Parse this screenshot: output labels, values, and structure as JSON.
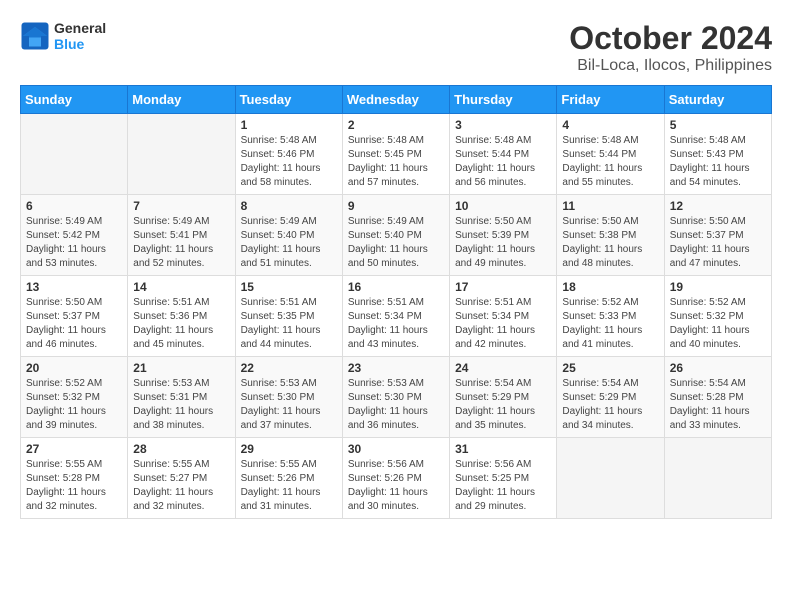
{
  "header": {
    "logo_line1": "General",
    "logo_line2": "Blue",
    "title": "October 2024",
    "subtitle": "Bil-Loca, Ilocos, Philippines"
  },
  "weekdays": [
    "Sunday",
    "Monday",
    "Tuesday",
    "Wednesday",
    "Thursday",
    "Friday",
    "Saturday"
  ],
  "weeks": [
    [
      {
        "day": "",
        "info": ""
      },
      {
        "day": "",
        "info": ""
      },
      {
        "day": "1",
        "info": "Sunrise: 5:48 AM\nSunset: 5:46 PM\nDaylight: 11 hours and 58 minutes."
      },
      {
        "day": "2",
        "info": "Sunrise: 5:48 AM\nSunset: 5:45 PM\nDaylight: 11 hours and 57 minutes."
      },
      {
        "day": "3",
        "info": "Sunrise: 5:48 AM\nSunset: 5:44 PM\nDaylight: 11 hours and 56 minutes."
      },
      {
        "day": "4",
        "info": "Sunrise: 5:48 AM\nSunset: 5:44 PM\nDaylight: 11 hours and 55 minutes."
      },
      {
        "day": "5",
        "info": "Sunrise: 5:48 AM\nSunset: 5:43 PM\nDaylight: 11 hours and 54 minutes."
      }
    ],
    [
      {
        "day": "6",
        "info": "Sunrise: 5:49 AM\nSunset: 5:42 PM\nDaylight: 11 hours and 53 minutes."
      },
      {
        "day": "7",
        "info": "Sunrise: 5:49 AM\nSunset: 5:41 PM\nDaylight: 11 hours and 52 minutes."
      },
      {
        "day": "8",
        "info": "Sunrise: 5:49 AM\nSunset: 5:40 PM\nDaylight: 11 hours and 51 minutes."
      },
      {
        "day": "9",
        "info": "Sunrise: 5:49 AM\nSunset: 5:40 PM\nDaylight: 11 hours and 50 minutes."
      },
      {
        "day": "10",
        "info": "Sunrise: 5:50 AM\nSunset: 5:39 PM\nDaylight: 11 hours and 49 minutes."
      },
      {
        "day": "11",
        "info": "Sunrise: 5:50 AM\nSunset: 5:38 PM\nDaylight: 11 hours and 48 minutes."
      },
      {
        "day": "12",
        "info": "Sunrise: 5:50 AM\nSunset: 5:37 PM\nDaylight: 11 hours and 47 minutes."
      }
    ],
    [
      {
        "day": "13",
        "info": "Sunrise: 5:50 AM\nSunset: 5:37 PM\nDaylight: 11 hours and 46 minutes."
      },
      {
        "day": "14",
        "info": "Sunrise: 5:51 AM\nSunset: 5:36 PM\nDaylight: 11 hours and 45 minutes."
      },
      {
        "day": "15",
        "info": "Sunrise: 5:51 AM\nSunset: 5:35 PM\nDaylight: 11 hours and 44 minutes."
      },
      {
        "day": "16",
        "info": "Sunrise: 5:51 AM\nSunset: 5:34 PM\nDaylight: 11 hours and 43 minutes."
      },
      {
        "day": "17",
        "info": "Sunrise: 5:51 AM\nSunset: 5:34 PM\nDaylight: 11 hours and 42 minutes."
      },
      {
        "day": "18",
        "info": "Sunrise: 5:52 AM\nSunset: 5:33 PM\nDaylight: 11 hours and 41 minutes."
      },
      {
        "day": "19",
        "info": "Sunrise: 5:52 AM\nSunset: 5:32 PM\nDaylight: 11 hours and 40 minutes."
      }
    ],
    [
      {
        "day": "20",
        "info": "Sunrise: 5:52 AM\nSunset: 5:32 PM\nDaylight: 11 hours and 39 minutes."
      },
      {
        "day": "21",
        "info": "Sunrise: 5:53 AM\nSunset: 5:31 PM\nDaylight: 11 hours and 38 minutes."
      },
      {
        "day": "22",
        "info": "Sunrise: 5:53 AM\nSunset: 5:30 PM\nDaylight: 11 hours and 37 minutes."
      },
      {
        "day": "23",
        "info": "Sunrise: 5:53 AM\nSunset: 5:30 PM\nDaylight: 11 hours and 36 minutes."
      },
      {
        "day": "24",
        "info": "Sunrise: 5:54 AM\nSunset: 5:29 PM\nDaylight: 11 hours and 35 minutes."
      },
      {
        "day": "25",
        "info": "Sunrise: 5:54 AM\nSunset: 5:29 PM\nDaylight: 11 hours and 34 minutes."
      },
      {
        "day": "26",
        "info": "Sunrise: 5:54 AM\nSunset: 5:28 PM\nDaylight: 11 hours and 33 minutes."
      }
    ],
    [
      {
        "day": "27",
        "info": "Sunrise: 5:55 AM\nSunset: 5:28 PM\nDaylight: 11 hours and 32 minutes."
      },
      {
        "day": "28",
        "info": "Sunrise: 5:55 AM\nSunset: 5:27 PM\nDaylight: 11 hours and 32 minutes."
      },
      {
        "day": "29",
        "info": "Sunrise: 5:55 AM\nSunset: 5:26 PM\nDaylight: 11 hours and 31 minutes."
      },
      {
        "day": "30",
        "info": "Sunrise: 5:56 AM\nSunset: 5:26 PM\nDaylight: 11 hours and 30 minutes."
      },
      {
        "day": "31",
        "info": "Sunrise: 5:56 AM\nSunset: 5:25 PM\nDaylight: 11 hours and 29 minutes."
      },
      {
        "day": "",
        "info": ""
      },
      {
        "day": "",
        "info": ""
      }
    ]
  ]
}
